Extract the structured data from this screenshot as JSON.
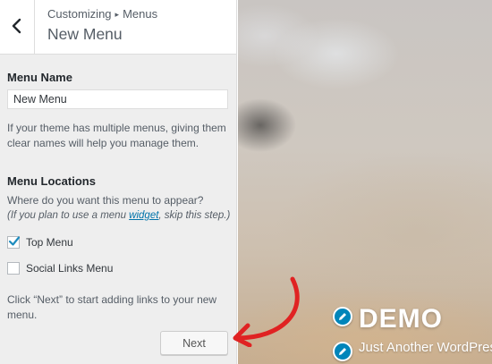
{
  "header": {
    "breadcrumb_root": "Customizing",
    "breadcrumb_sep": "▸",
    "breadcrumb_current": "Menus",
    "title": "New Menu"
  },
  "menu_name": {
    "label": "Menu Name",
    "value": "New Menu",
    "help": "If your theme has multiple menus, giving them clear names will help you manage them."
  },
  "menu_locations": {
    "heading": "Menu Locations",
    "question": "Where do you want this menu to appear?",
    "hint_prefix": "(If you plan to use a menu ",
    "hint_link": "widget",
    "hint_suffix": ", skip this step.)",
    "options": [
      {
        "label": "Top Menu",
        "checked": true
      },
      {
        "label": "Social Links Menu",
        "checked": false
      }
    ]
  },
  "footer": {
    "instruction": "Click “Next” to start adding links to your new menu.",
    "next_label": "Next"
  },
  "preview": {
    "site_title": "DEMO",
    "tagline": "Just Another WordPress"
  },
  "colors": {
    "accent": "#0073aa",
    "edit_icon": "#0085ba",
    "annotation_arrow": "#e02222"
  }
}
